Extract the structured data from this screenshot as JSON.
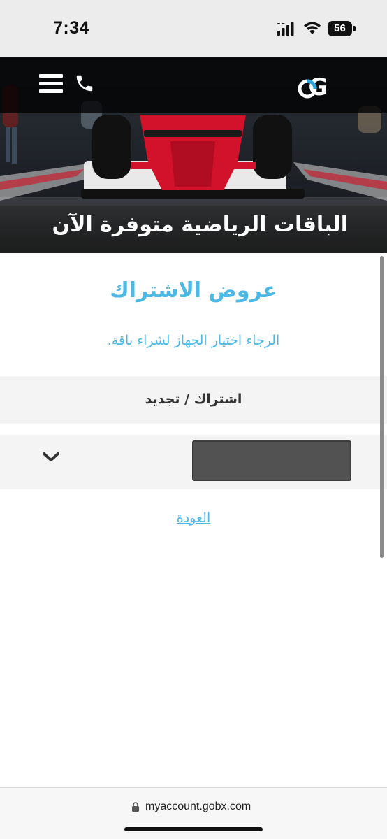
{
  "status_bar": {
    "time": "7:34",
    "battery_level": "56",
    "icons": [
      "signal-icon",
      "wifi-icon",
      "battery-icon"
    ]
  },
  "header": {
    "logo_text": "Gobx",
    "icons": [
      "menu-icon",
      "phone-icon"
    ],
    "banner_caption": "الباقات الرياضية متوفرة الآن"
  },
  "main": {
    "title": "عروض الاشتراك",
    "subtitle": "الرجاء اختيار الجهاز لشراء باقة.",
    "section_header": "اشتراك / تجديد",
    "device_select": {
      "value": "",
      "icon": "chevron-down-icon"
    },
    "back_link": "العودة"
  },
  "browser": {
    "url": "myaccount.gobx.com",
    "icon": "lock-icon"
  },
  "colors": {
    "accent": "#4cb8e6",
    "banner_red": "#d2112a",
    "select_bg": "#525252",
    "row_bg": "#f4f4f4"
  }
}
